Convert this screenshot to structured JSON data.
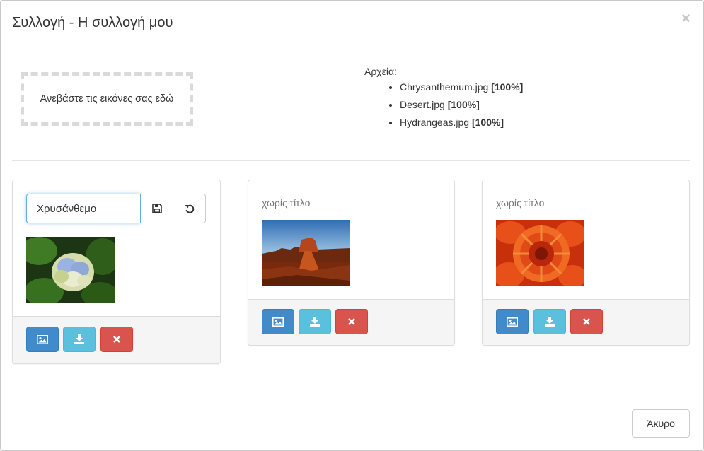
{
  "modal": {
    "title": "Συλλογή - Η συλλογή μου",
    "close_symbol": "×"
  },
  "upload": {
    "dropzone_text": "Ανεβάστε τις εικόνες σας εδώ",
    "files_label": "Αρχεία:",
    "files": [
      {
        "name": "Chrysanthemum.jpg",
        "progress": "[100%]"
      },
      {
        "name": "Desert.jpg",
        "progress": "[100%]"
      },
      {
        "name": "Hydrangeas.jpg",
        "progress": "[100%]"
      }
    ]
  },
  "cards": [
    {
      "title_input_value": "Χρυσάνθεμο",
      "image": "hydrangea-photo",
      "editing": true
    },
    {
      "title": "χωρίς τίτλο",
      "image": "desert-photo",
      "editing": false
    },
    {
      "title": "χωρίς τίτλο",
      "image": "chrysanthemum-photo",
      "editing": false
    }
  ],
  "card_actions": {
    "icons": [
      "image-icon",
      "download-icon",
      "remove-icon"
    ],
    "colors": {
      "primary": "#428bca",
      "info": "#5bc0de",
      "danger": "#d9534f"
    }
  },
  "footer": {
    "cancel_label": "Άκυρο"
  }
}
